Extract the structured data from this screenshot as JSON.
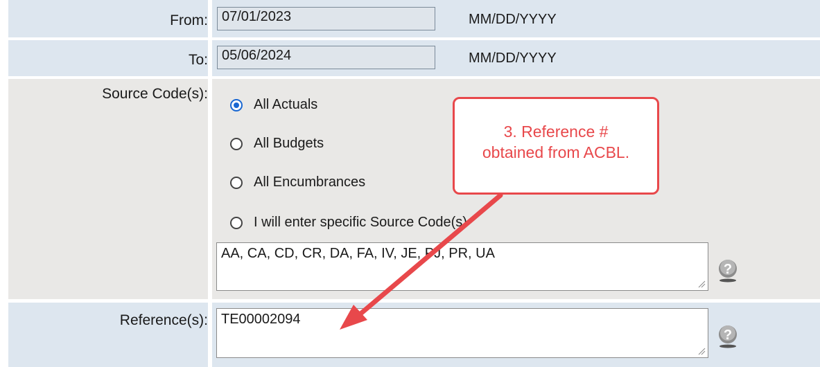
{
  "from": {
    "label": "From:",
    "value": "07/01/2023",
    "format_hint": "MM/DD/YYYY"
  },
  "to": {
    "label": "To:",
    "value": "05/06/2024",
    "format_hint": "MM/DD/YYYY"
  },
  "source_codes": {
    "label": "Source Code(s):",
    "options": [
      {
        "label": "All Actuals",
        "checked": true
      },
      {
        "label": "All Budgets",
        "checked": false
      },
      {
        "label": "All Encumbrances",
        "checked": false
      },
      {
        "label": "I will enter specific Source Code(s)",
        "checked": false
      }
    ],
    "codes_value": "AA, CA, CD, CR, DA, FA, IV, JE, PJ, PR, UA",
    "help_icon": "question-mark-icon"
  },
  "references": {
    "label": "Reference(s):",
    "value": "TE00002094",
    "help_icon": "question-mark-icon"
  },
  "callout": {
    "line1": "3. Reference #",
    "line2": "obtained from ACBL."
  },
  "colors": {
    "row_blue": "#dde6ef",
    "row_grey": "#e9e8e6",
    "callout_red": "#e8484b",
    "radio_blue": "#1967d2"
  }
}
